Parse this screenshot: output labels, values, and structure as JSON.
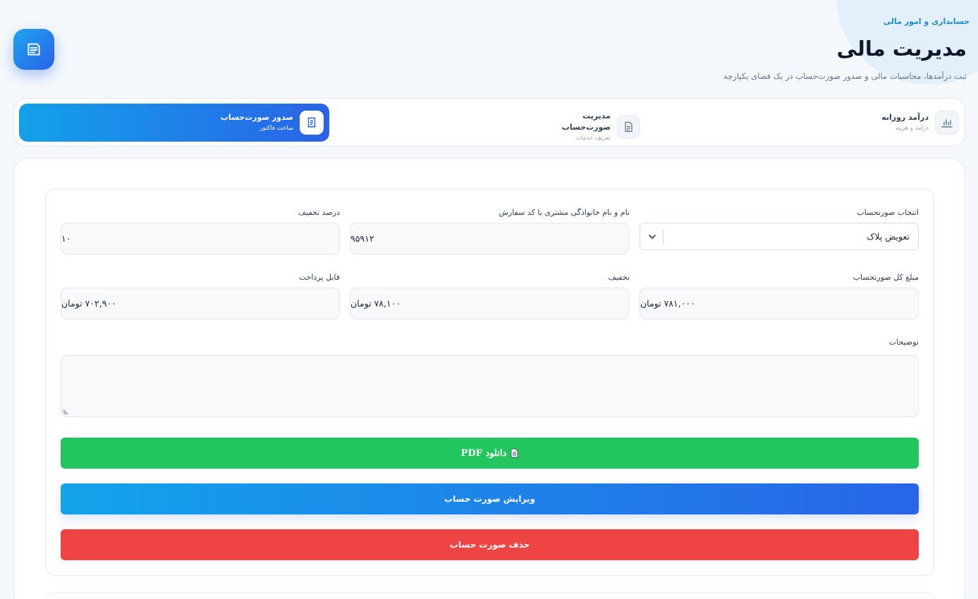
{
  "header": {
    "eyebrow": "حسابداری و امور مالی",
    "title": "مدیریت مالی",
    "subtitle": "ثبت درآمدها، محاسبات مالی و صدور صورت‌حساب در یک فضای یکپارچه",
    "app_icon": "document-icon"
  },
  "tabs": [
    {
      "title": "درآمد روزانه",
      "subtitle": "درآمد و هزینه",
      "icon": "bar-chart-icon",
      "active": false
    },
    {
      "title": "مدیریت صورت‌حساب",
      "subtitle": "تعریف خدمات",
      "icon": "document-icon",
      "active": false
    },
    {
      "title": "صدور صورت‌حساب",
      "subtitle": "ساخت فاکتور",
      "icon": "receipt-icon",
      "active": true
    }
  ],
  "form": {
    "invoice_select": {
      "label": "انتخاب صورتحساب",
      "value": "تعویض پلاک"
    },
    "customer": {
      "label": "نام و نام خانوادگی مشتری یا کد سفارش",
      "value": "۹۵۹۱۲"
    },
    "discount_percent": {
      "label": "درصد تخفیف",
      "value": "۱۰"
    },
    "total": {
      "label": "مبلغ کل صورتحساب",
      "value": "۷۸۱,۰۰۰ تومان"
    },
    "discount": {
      "label": "تخفیف",
      "value": "۷۸,۱۰۰ تومان"
    },
    "payable": {
      "label": "قابل پرداخت",
      "value": "۷۰۲,۹۰۰ تومان"
    },
    "notes": {
      "label": "توضیحات",
      "value": ""
    }
  },
  "buttons": {
    "pdf": "دانلود PDF",
    "edit": "ویرایش صورت حساب",
    "delete": "حذف صورت حساب"
  },
  "colors": {
    "accent": "#2563eb",
    "success": "#22c55e",
    "danger": "#ef4444"
  }
}
